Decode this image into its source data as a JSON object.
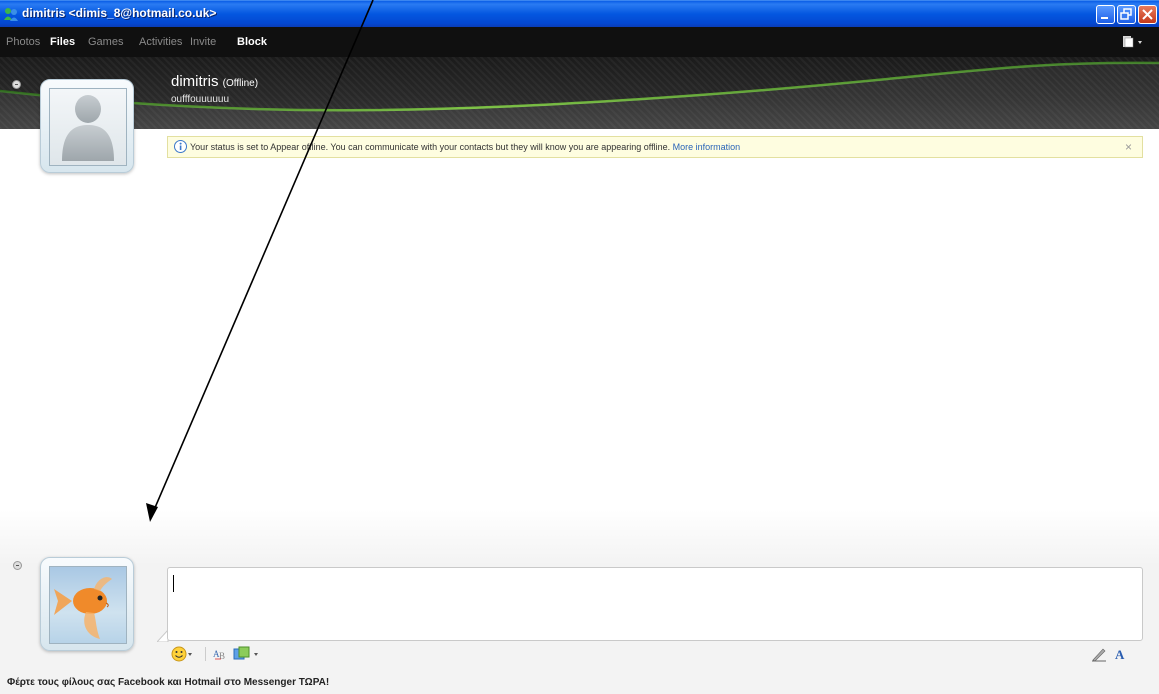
{
  "window": {
    "title": "dimitris <dimis_8@hotmail.co.uk>"
  },
  "menu": {
    "items": [
      {
        "label": "Photos",
        "active": false
      },
      {
        "label": "Files",
        "active": true
      },
      {
        "label": "Games",
        "active": false
      },
      {
        "label": "Activities",
        "active": false
      },
      {
        "label": "Invite",
        "active": false
      },
      {
        "label": "Block",
        "active": true
      }
    ]
  },
  "contact": {
    "name": "dimitris",
    "status": "(Offline)",
    "personal_message": "oufffouuuuuu"
  },
  "infobar": {
    "message": "Your status is set to Appear offline. You can communicate with your contacts but they will know you are appearing offline.",
    "link": "More information",
    "close": "×"
  },
  "compose": {
    "value": ""
  },
  "promo": {
    "text": "Φέρτε τους φίλους σας Facebook και Hotmail στο Messenger ΤΩΡΑ!"
  },
  "colors": {
    "titlebar": "#0457e0",
    "menubar": "#101010",
    "accent_green": "#7bc142",
    "link": "#2a64b8",
    "infobar_bg": "#fefde0"
  }
}
